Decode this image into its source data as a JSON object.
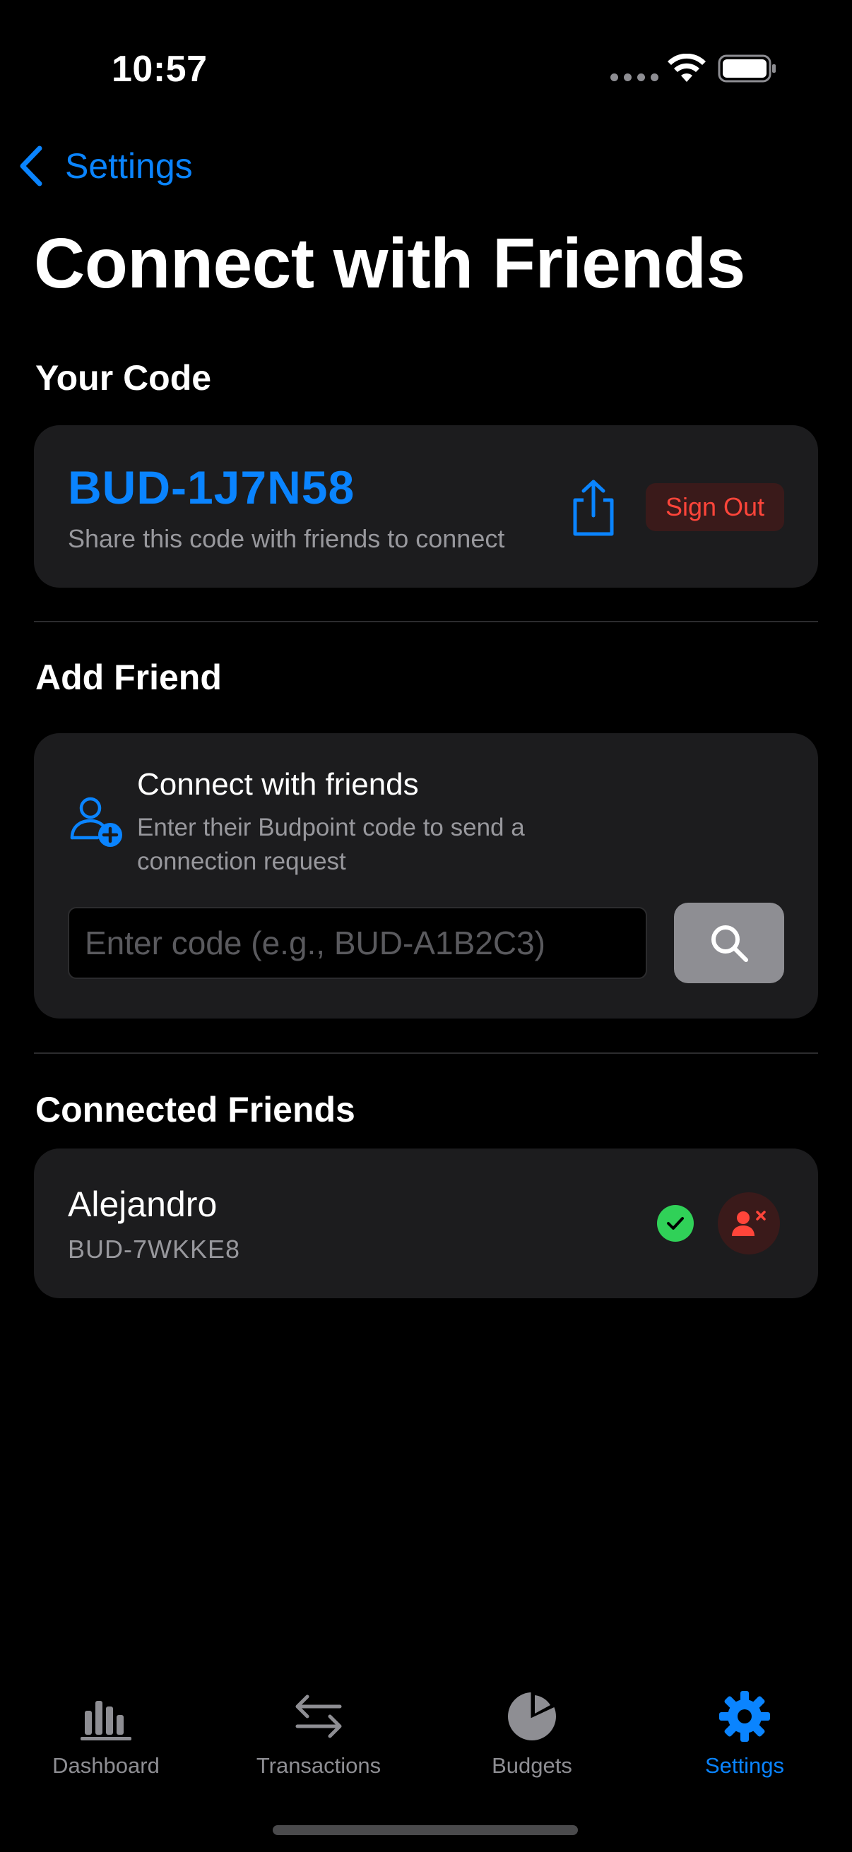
{
  "status": {
    "time": "10:57"
  },
  "nav": {
    "back_label": "Settings"
  },
  "page": {
    "title": "Connect with Friends"
  },
  "your_code": {
    "section_title": "Your Code",
    "code": "BUD-1J7N58",
    "hint": "Share this code with friends to connect",
    "sign_out_label": "Sign Out"
  },
  "add_friend": {
    "section_title": "Add Friend",
    "title": "Connect with friends",
    "description": "Enter their Budpoint code to send a connection request",
    "input_placeholder": "Enter code (e.g., BUD-A1B2C3)",
    "input_value": ""
  },
  "connected": {
    "section_title": "Connected Friends",
    "friends": [
      {
        "name": "Alejandro",
        "code": "BUD-7WKKE8",
        "status": "connected"
      }
    ]
  },
  "tabs": [
    {
      "label": "Dashboard",
      "icon": "chart-bar-icon",
      "active": false
    },
    {
      "label": "Transactions",
      "icon": "arrows-swap-icon",
      "active": false
    },
    {
      "label": "Budgets",
      "icon": "pie-chart-icon",
      "active": false
    },
    {
      "label": "Settings",
      "icon": "gear-icon",
      "active": true
    }
  ],
  "colors": {
    "accent": "#0a84ff",
    "destructive": "#ff453a",
    "success": "#30d158",
    "card": "#1c1c1e",
    "background": "#000000"
  }
}
